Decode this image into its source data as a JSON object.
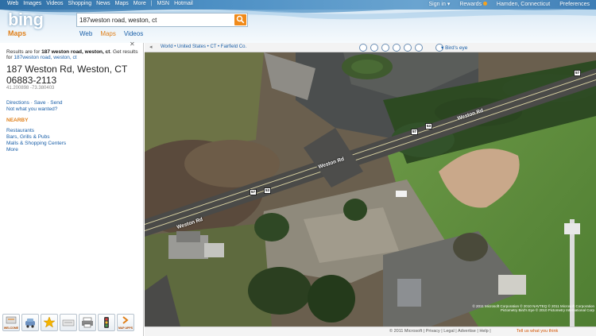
{
  "topnav": {
    "items": [
      "Web",
      "Images",
      "Videos",
      "Shopping",
      "News",
      "Maps",
      "More",
      "MSN",
      "Hotmail"
    ]
  },
  "topright": {
    "signin": "Sign in ▾",
    "rewards": "Rewards",
    "location": "Hamden, Connecticut",
    "preferences": "Preferences"
  },
  "brand": {
    "logo": "bing",
    "product": "Maps",
    "accent": "#f08a1a"
  },
  "search": {
    "value": "187weston road, weston, ct"
  },
  "vertical_tabs": [
    {
      "label": "Web"
    },
    {
      "label": "Maps"
    },
    {
      "label": "Videos"
    }
  ],
  "results": {
    "prefix": "Results are for",
    "query_bold": "187 weston road, weston, ct",
    "suffix": ". Get results",
    "for_label": "for",
    "alt_query": "187weston road, weston, ct",
    "address": "187 Weston Rd, Weston, CT",
    "zip": "06883-2113",
    "coords": "41.200898 -73.380403",
    "directions": "Directions",
    "save": "Save",
    "send": "Send",
    "not_wanted": "Not what you wanted?",
    "nearby_label": "NEARBY",
    "nearby_items": [
      "Restaurants",
      "Bars, Grills & Pubs",
      "Malls & Shopping Centers",
      "More"
    ]
  },
  "bottom_toolbar": {
    "welcome_label": "WELCOME",
    "mapapps_label": "MAP APPS"
  },
  "map_toolbar": {
    "breadcrumb": "World • United States • CT • Fairfield Co.",
    "view": "Bird's eye"
  },
  "map": {
    "road_label_1": "Weston Rd",
    "road_label_2": "Weston Rd",
    "road_label_3": "Weston Rd",
    "shield_1": "57",
    "shield_2": "53",
    "shield_3": "57",
    "shield_4": "53",
    "shield_5": "57",
    "copyright": "© 2011 Microsoft Corporation  © 2010 NAVTEQ  © 2011 Microsoft Corporation  Pictometry Bird's Eye © 2010 Pictometry International Corp"
  },
  "footer": {
    "copyright": "© 2011 Microsoft",
    "links": [
      "Privacy",
      "Legal",
      "Advertise",
      "Help"
    ],
    "feedback": "Tell us what you think"
  }
}
